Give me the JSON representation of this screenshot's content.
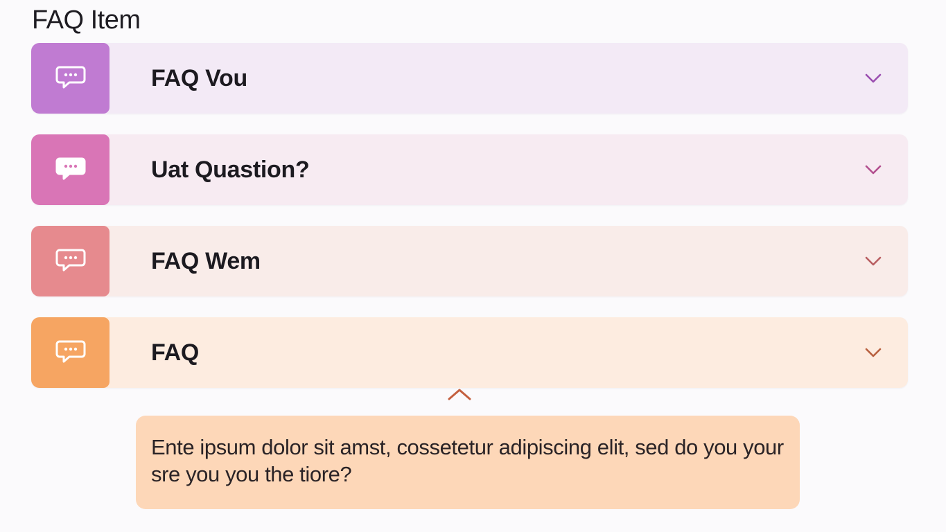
{
  "page": {
    "title": "FAQ Item"
  },
  "faq": {
    "items": [
      {
        "label": "FAQ Vou",
        "icon": "chat-bubble-icon",
        "accent": "#c07bd2",
        "background": "#f3eaf6",
        "chevron_color": "#9b4fb0",
        "expanded": false
      },
      {
        "label": "Uat Quastion?",
        "icon": "chat-bubble-icon",
        "accent": "#d975b6",
        "background": "#f7ebf2",
        "chevron_color": "#b24f8f",
        "expanded": false
      },
      {
        "label": "FAQ Wem",
        "icon": "chat-bubble-icon",
        "accent": "#e68a8e",
        "background": "#f9ece9",
        "chevron_color": "#b95f62",
        "expanded": false
      },
      {
        "label": "FAQ",
        "icon": "chat-bubble-icon",
        "accent": "#f6a562",
        "background": "#fdece0",
        "chevron_color": "#b8603f",
        "expanded": true
      }
    ]
  },
  "answer": {
    "text": "Ente ipsum dolor sit amst, cossetetur adipiscing elit, sed do you your sre you you the tiore?",
    "background": "#fdd7b8",
    "caret_color": "#c4603f",
    "caret_icon": "chevron-up-icon"
  }
}
